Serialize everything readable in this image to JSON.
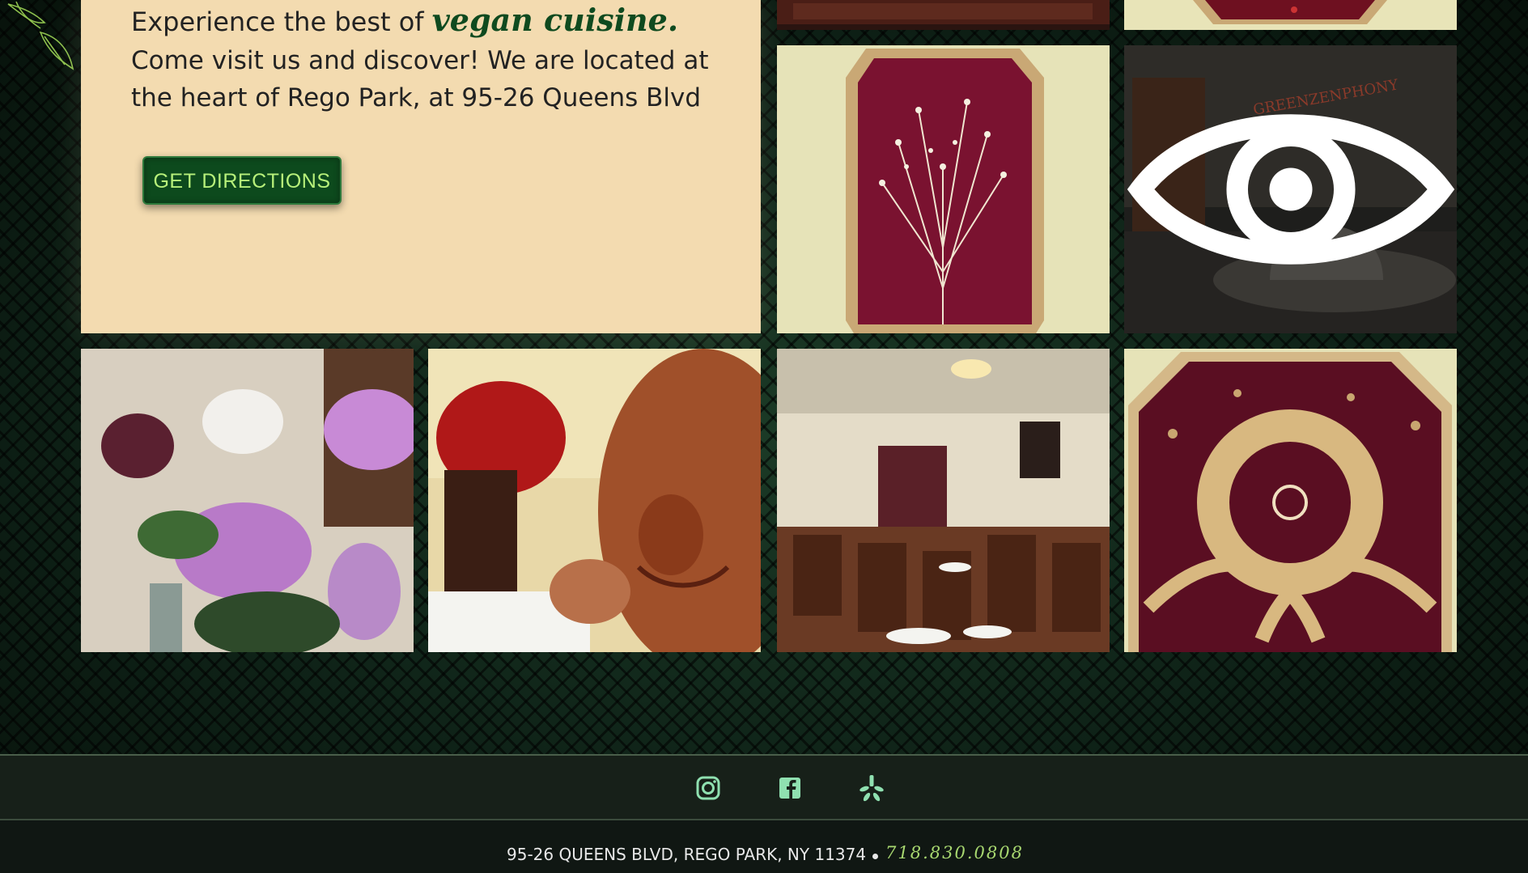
{
  "info": {
    "line1_prefix": "Experience the best of",
    "line1_highlight": "vegan cuisine.",
    "line2": "Come visit us and discover! We are located at the heart of Rego Park, at 95-26 Queens Blvd",
    "directions_button": "GET DIRECTIONS"
  },
  "gallery": {
    "top_left": "restaurant-interior-photo",
    "top_right": "framed-dried-flowers-photo",
    "mid_left": "framed-dried-branches-photo",
    "mid_right": "greenzenphony-interior-photo",
    "bottom_1": "lotus-flowers-photo",
    "bottom_2": "buddha-statue-photo",
    "bottom_3": "dining-room-photo",
    "bottom_4": "wheat-wreath-photo",
    "sign_text": "GREENZENPHONY"
  },
  "footer": {
    "social": [
      "instagram-icon",
      "facebook-icon",
      "yelp-icon"
    ],
    "address": "95-26 QUEENS BLVD, REGO PARK, NY 11374",
    "phone": "718.830.0808"
  },
  "colors": {
    "panel": "#f3dbb0",
    "button": "#0d4a1d",
    "button_text": "#b7f07a",
    "footer": "#172019",
    "accent": "#a8d870"
  }
}
